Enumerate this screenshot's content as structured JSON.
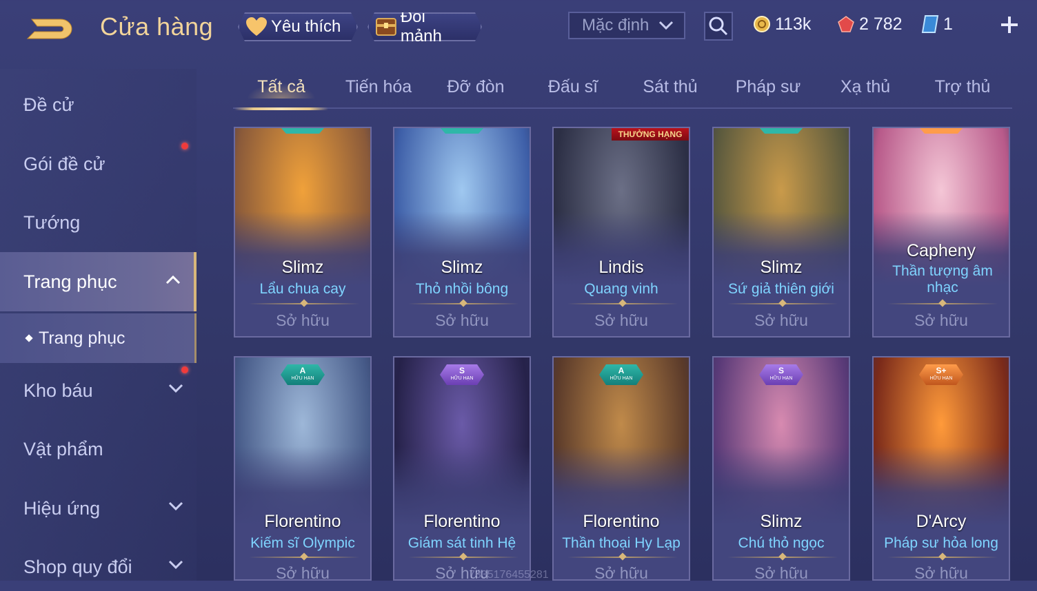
{
  "header": {
    "title": "Cửa hàng",
    "favorite_label": "Yêu thích",
    "exchange_label": "Đổi mảnh",
    "sort_value": "Mặc định",
    "currencies": {
      "gold": "113k",
      "ruby": "2 782",
      "voucher": "1"
    }
  },
  "sidebar": {
    "items": [
      {
        "label": "Đề cử"
      },
      {
        "label": "Gói đề cử"
      },
      {
        "label": "Tướng"
      },
      {
        "label": "Trang phục"
      },
      {
        "label": "Trang phục"
      },
      {
        "label": "Kho báu"
      },
      {
        "label": "Vật phẩm"
      },
      {
        "label": "Hiệu ứng"
      },
      {
        "label": "Shop quy đổi"
      }
    ]
  },
  "tabs": [
    "Tất cả",
    "Tiến hóa",
    "Đỡ đòn",
    "Đấu sĩ",
    "Sát thủ",
    "Pháp sư",
    "Xạ thủ",
    "Trợ thủ"
  ],
  "cards": [
    {
      "hero": "Slimz",
      "skin": "Lẩu chua cay",
      "status": "Sở hữu",
      "colors": [
        "#f0a13a",
        "#8a5a3a"
      ]
    },
    {
      "hero": "Slimz",
      "skin": "Thỏ nhồi bông",
      "status": "Sở hữu",
      "colors": [
        "#9fc8f0",
        "#3e5fa8"
      ]
    },
    {
      "hero": "Lindis",
      "skin": "Quang vinh",
      "status": "Sở hữu",
      "ribbon": "THƯỞNG HẠNG",
      "colors": [
        "#6b6f86",
        "#2c2f45"
      ]
    },
    {
      "hero": "Slimz",
      "skin": "Sứ giả thiên giới",
      "status": "Sở hữu",
      "colors": [
        "#c99a4a",
        "#5b5a3e"
      ]
    },
    {
      "hero": "Capheny",
      "skin": "Thần tượng âm nhạc",
      "status": "Sở hữu",
      "colors": [
        "#f4c6d6",
        "#b85a8a"
      ]
    },
    {
      "hero": "Florentino",
      "skin": "Kiếm sĩ Olympic",
      "status": "Sở hữu",
      "tier": "A",
      "limited": "HỮU HẠN",
      "badge": "teal",
      "colors": [
        "#9db7d8",
        "#465a88"
      ]
    },
    {
      "hero": "Florentino",
      "skin": "Giám sát tinh Hệ",
      "status": "Sở hữu",
      "tier": "S",
      "limited": "HỮU HẠN",
      "badge": "purple",
      "colors": [
        "#6a5aa8",
        "#26224a"
      ]
    },
    {
      "hero": "Florentino",
      "skin": "Thần thoại Hy Lạp",
      "status": "Sở hữu",
      "tier": "A",
      "limited": "HỮU HẠN",
      "badge": "teal",
      "colors": [
        "#c08a4a",
        "#5a3a2a"
      ]
    },
    {
      "hero": "Slimz",
      "skin": "Chú thỏ ngọc",
      "status": "Sở hữu",
      "tier": "S",
      "limited": "HỮU HẠN",
      "badge": "purple",
      "colors": [
        "#d78ab0",
        "#5a3a78"
      ]
    },
    {
      "hero": "D'Arcy",
      "skin": "Pháp sư hỏa long",
      "status": "Sở hữu",
      "tier": "S+",
      "limited": "HỮU HẠN",
      "badge": "orange",
      "colors": [
        "#ff9a3a",
        "#7a2a1a"
      ]
    }
  ],
  "watermark": "7335176455281"
}
